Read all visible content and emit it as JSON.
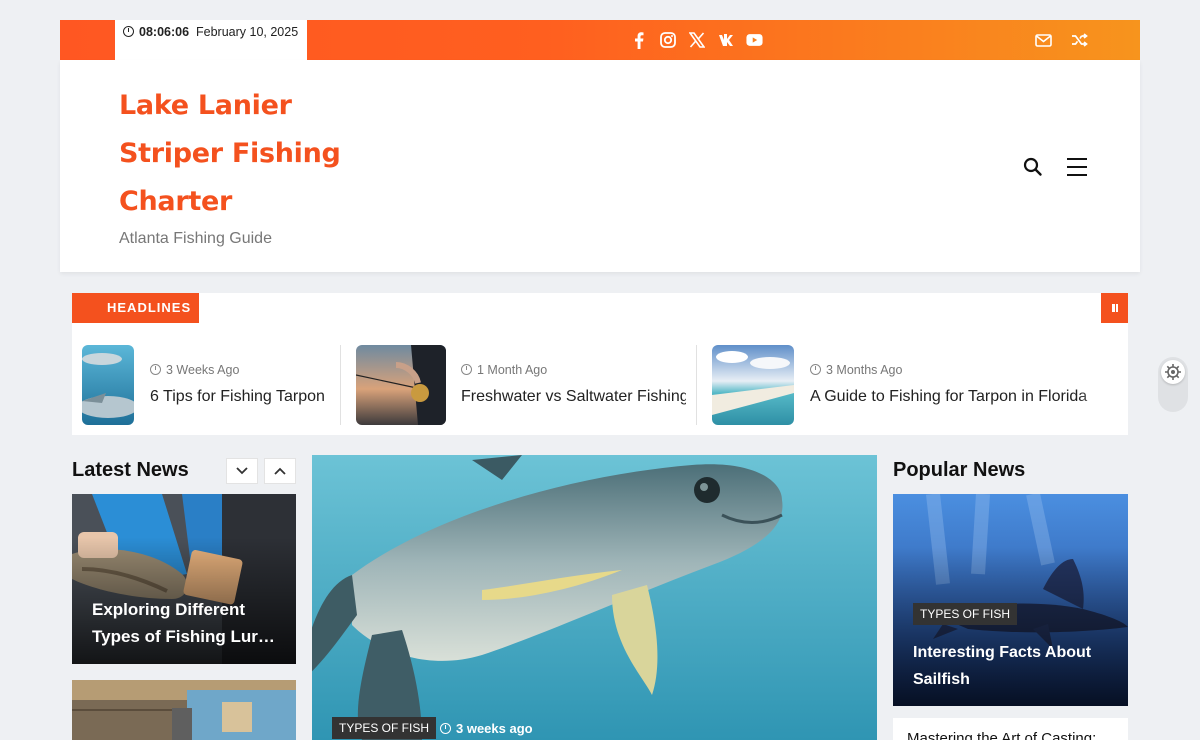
{
  "topbar": {
    "time": "08:06:06",
    "date": "February 10, 2025",
    "socials": [
      "facebook-icon",
      "instagram-icon",
      "x-icon",
      "vk-icon",
      "youtube-icon"
    ],
    "right_icons": [
      "mail-icon",
      "shuffle-icon"
    ],
    "gradient_start": "#ff5722",
    "gradient_end": "#f7941d"
  },
  "header": {
    "site_title": "Lake Lanier Striper Fishing Charter",
    "tagline": "Atlanta Fishing Guide",
    "accent": "#f4511e"
  },
  "headlines": {
    "label": "HEADLINES",
    "items": [
      {
        "meta": "3 Weeks Ago",
        "title": "6 Tips for Fishing Tarpon"
      },
      {
        "meta": "1 Month Ago",
        "title": "Freshwater vs Saltwater Fishing"
      },
      {
        "meta": "3 Months Ago",
        "title": "A Guide to Fishing for Tarpon in Florida"
      }
    ]
  },
  "latest_news": {
    "title": "Latest News",
    "cards": [
      {
        "title": "Exploring Different Types of Fishing Lur…"
      }
    ]
  },
  "featured": {
    "category": "TYPES OF FISH",
    "meta": "3 weeks ago"
  },
  "popular_news": {
    "title": "Popular News",
    "cards": [
      {
        "category": "TYPES OF FISH",
        "title": "Interesting Facts About Sailfish"
      },
      {
        "title": "Mastering the Art of Casting:"
      }
    ]
  }
}
